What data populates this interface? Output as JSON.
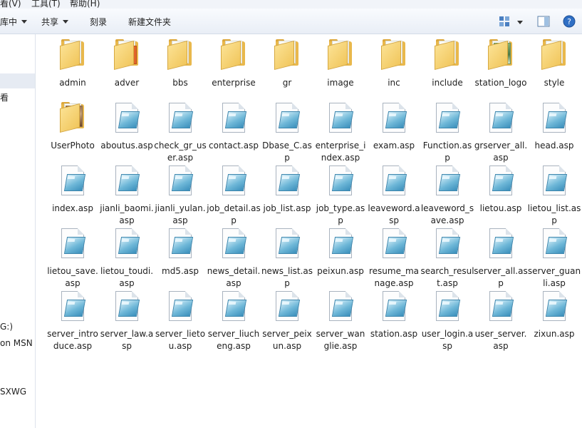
{
  "menu": {
    "view": "看(V)",
    "tools": "工具(T)",
    "help": "帮助(H)"
  },
  "toolbar": {
    "include_in_library": "库中",
    "share": "共享",
    "burn": "刻录",
    "new_folder": "新建文件夹"
  },
  "nav": {
    "item1": "看",
    "item2": "G:)",
    "item3": "on MSN",
    "item4": "SXWG"
  },
  "colors": {
    "folder": "#e9b84c",
    "asp_icon": "#6fb8d8",
    "selection": "#e6ebf3",
    "toolbar_bg": "#eef2f8"
  },
  "files": [
    {
      "name": "admin",
      "type": "folder"
    },
    {
      "name": "adver",
      "type": "folder",
      "thumb": "orange"
    },
    {
      "name": "bbs",
      "type": "folder"
    },
    {
      "name": "enterprise",
      "type": "folder"
    },
    {
      "name": "gr",
      "type": "folder"
    },
    {
      "name": "image",
      "type": "folder",
      "thumb": "red"
    },
    {
      "name": "inc",
      "type": "folder"
    },
    {
      "name": "include",
      "type": "folder"
    },
    {
      "name": "station_logo",
      "type": "folder",
      "thumb": "green"
    },
    {
      "name": "style",
      "type": "folder"
    },
    {
      "name": "UserPhoto",
      "type": "folder",
      "thumb": "photo"
    },
    {
      "name": "aboutus.asp",
      "type": "asp"
    },
    {
      "name": "check_gr_user.asp",
      "type": "asp"
    },
    {
      "name": "contact.asp",
      "type": "asp"
    },
    {
      "name": "Dbase_C.asp",
      "type": "asp"
    },
    {
      "name": "enterprise_index.asp",
      "type": "asp"
    },
    {
      "name": "exam.asp",
      "type": "asp"
    },
    {
      "name": "Function.asp",
      "type": "asp"
    },
    {
      "name": "grserver_all.asp",
      "type": "asp"
    },
    {
      "name": "head.asp",
      "type": "asp"
    },
    {
      "name": "index.asp",
      "type": "asp"
    },
    {
      "name": "jianli_baomi.asp",
      "type": "asp"
    },
    {
      "name": "jianli_yulan.asp",
      "type": "asp"
    },
    {
      "name": "job_detail.asp",
      "type": "asp"
    },
    {
      "name": "job_list.asp",
      "type": "asp"
    },
    {
      "name": "job_type.asp",
      "type": "asp"
    },
    {
      "name": "leaveword.asp",
      "type": "asp"
    },
    {
      "name": "leaveword_save.asp",
      "type": "asp"
    },
    {
      "name": "lietou.asp",
      "type": "asp"
    },
    {
      "name": "lietou_list.asp",
      "type": "asp"
    },
    {
      "name": "lietou_save.asp",
      "type": "asp"
    },
    {
      "name": "lietou_toudi.asp",
      "type": "asp"
    },
    {
      "name": "md5.asp",
      "type": "asp"
    },
    {
      "name": "news_detail.asp",
      "type": "asp"
    },
    {
      "name": "news_list.asp",
      "type": "asp"
    },
    {
      "name": "peixun.asp",
      "type": "asp"
    },
    {
      "name": "resume_manage.asp",
      "type": "asp"
    },
    {
      "name": "search_result.asp",
      "type": "asp"
    },
    {
      "name": "server_all.asp",
      "type": "asp"
    },
    {
      "name": "server_guanli.asp",
      "type": "asp"
    },
    {
      "name": "server_introduce.asp",
      "type": "asp"
    },
    {
      "name": "server_law.asp",
      "type": "asp"
    },
    {
      "name": "server_lietou.asp",
      "type": "asp"
    },
    {
      "name": "server_liucheng.asp",
      "type": "asp"
    },
    {
      "name": "server_peixun.asp",
      "type": "asp"
    },
    {
      "name": "server_wanglie.asp",
      "type": "asp"
    },
    {
      "name": "station.asp",
      "type": "asp"
    },
    {
      "name": "user_login.asp",
      "type": "asp"
    },
    {
      "name": "user_server.asp",
      "type": "asp"
    },
    {
      "name": "zixun.asp",
      "type": "asp"
    }
  ]
}
